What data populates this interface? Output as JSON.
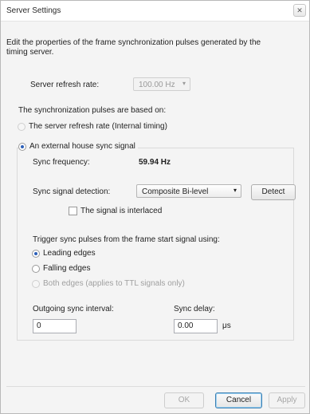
{
  "window": {
    "title": "Server Settings",
    "close_glyph": "✕"
  },
  "description": "Edit the properties of the frame synchronization pulses generated by the timing server.",
  "refresh_rate": {
    "label": "Server refresh rate:",
    "value": "100.00 Hz",
    "arrow": "▾"
  },
  "sync_source": {
    "label": "The synchronization pulses are based on:",
    "options": [
      {
        "label": "The server refresh rate (Internal timing)",
        "checked": false
      },
      {
        "label": "An external house sync signal",
        "checked": true
      }
    ]
  },
  "external": {
    "frequency_label": "Sync frequency:",
    "frequency_value": "59.94 Hz",
    "detection_label": "Sync signal detection:",
    "detection_value": "Composite Bi-level",
    "detection_arrow": "▾",
    "detect_button": "Detect",
    "interlaced_label": "The signal is interlaced",
    "trigger_label": "Trigger sync pulses from the frame start signal using:",
    "edges": [
      {
        "label": "Leading edges",
        "checked": true,
        "enabled": true
      },
      {
        "label": "Falling edges",
        "checked": false,
        "enabled": true
      },
      {
        "label": "Both edges (applies to TTL signals only)",
        "checked": false,
        "enabled": false
      }
    ],
    "interval_label": "Outgoing sync interval:",
    "interval_value": "0",
    "delay_label": "Sync delay:",
    "delay_value": "0.00",
    "delay_unit": "μs"
  },
  "buttons": {
    "ok": "OK",
    "cancel": "Cancel",
    "apply": "Apply"
  }
}
